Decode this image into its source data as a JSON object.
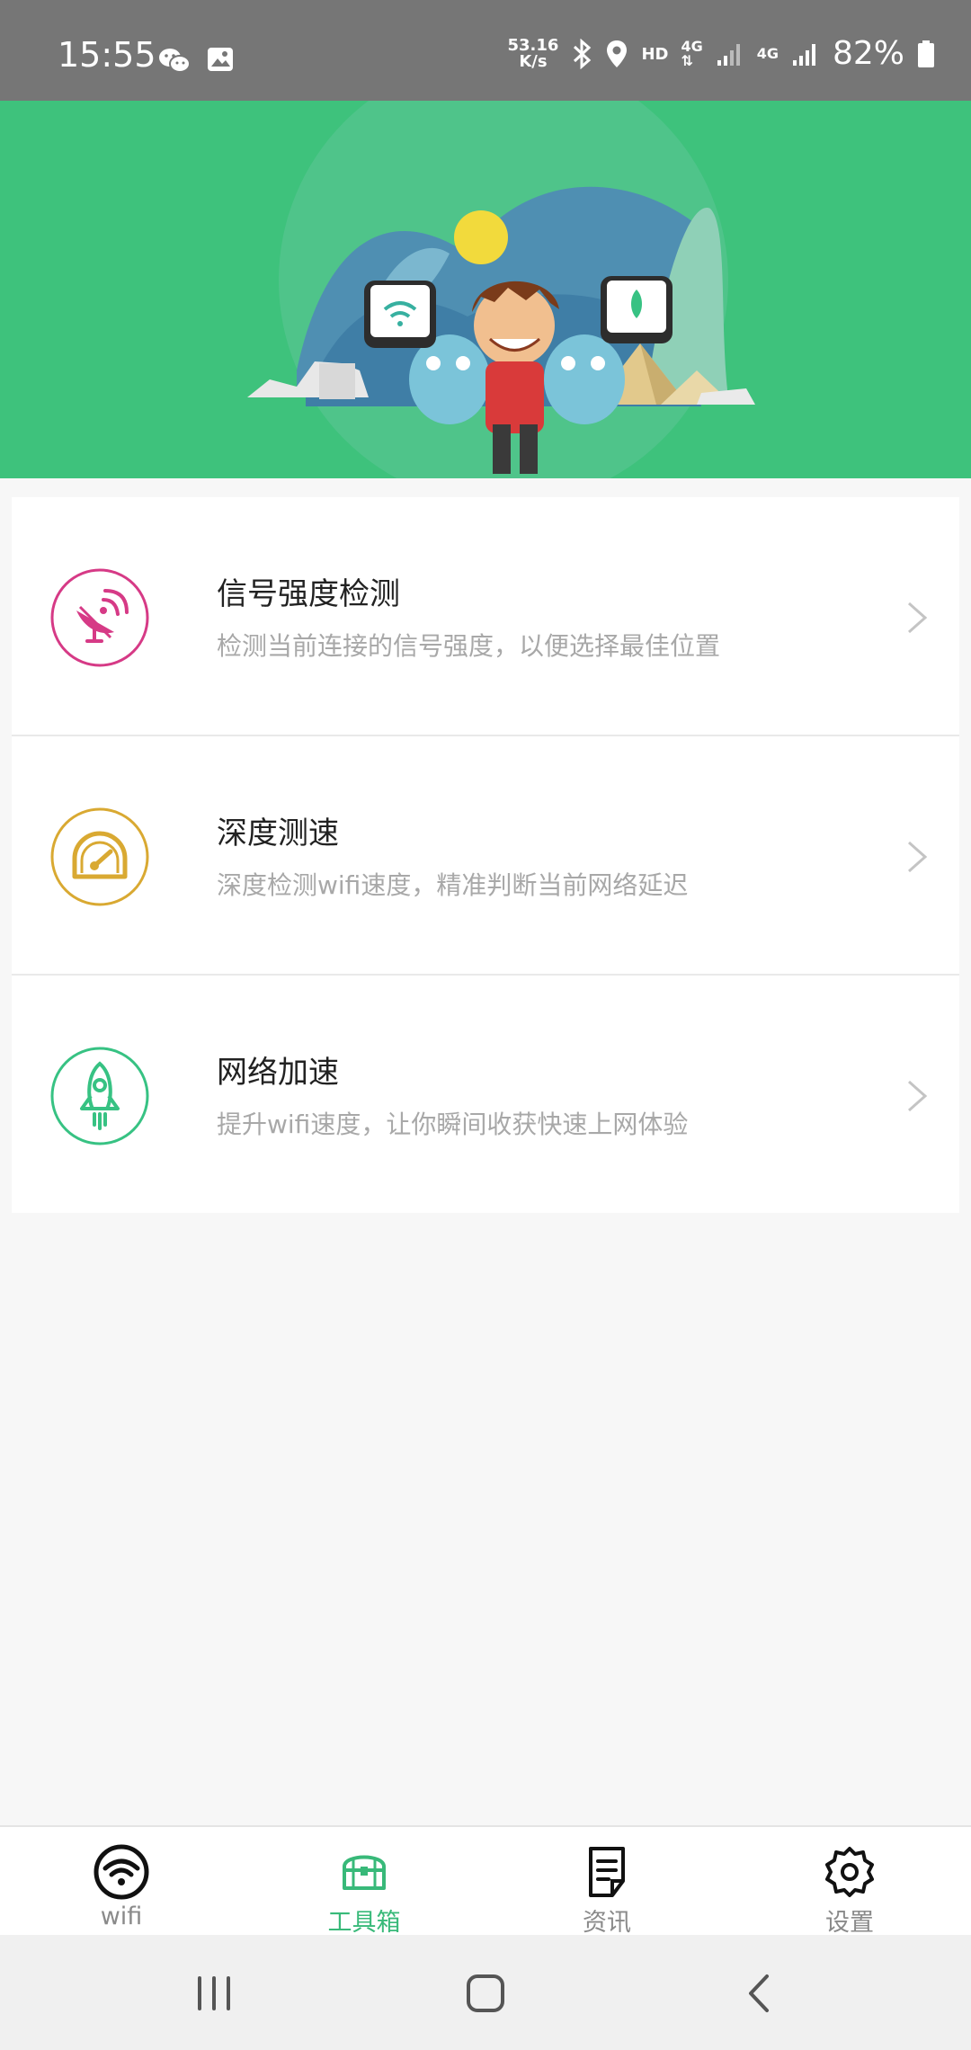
{
  "status_bar": {
    "time": "15:55",
    "net_speed_value": "53.16",
    "net_speed_unit": "K/s",
    "hd": "HD",
    "sig1": "4G",
    "sig2": "4G",
    "battery": "82%"
  },
  "tools": [
    {
      "title": "信号强度检测",
      "desc": "检测当前连接的信号强度，以便选择最佳位置",
      "icon": "satellite-dish-icon",
      "color": "#d63a86"
    },
    {
      "title": "深度测速",
      "desc": "深度检测wifi速度，精准判断当前网络延迟",
      "icon": "speedometer-icon",
      "color": "#d9a932"
    },
    {
      "title": "网络加速",
      "desc": "提升wifi速度，让你瞬间收获快速上网体验",
      "icon": "rocket-icon",
      "color": "#37c283"
    }
  ],
  "nav": {
    "wifi": "wifi",
    "toolbox": "工具箱",
    "news": "资讯",
    "settings": "设置"
  },
  "colors": {
    "accent": "#38b979",
    "banner": "#3ec27c"
  }
}
